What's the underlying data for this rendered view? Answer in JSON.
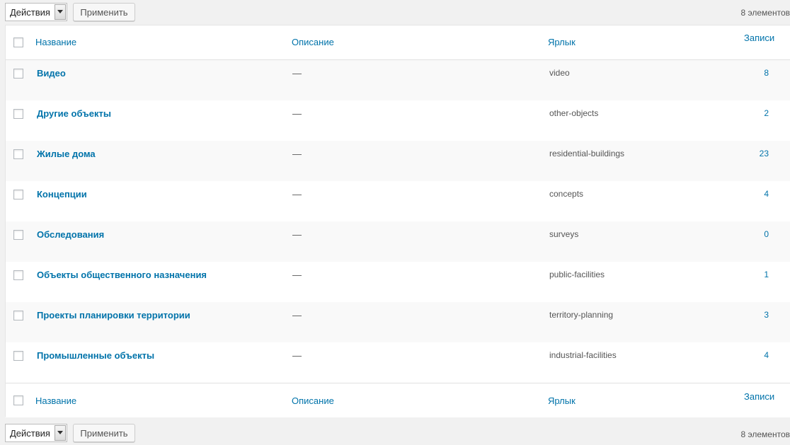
{
  "bulk_actions": {
    "select_label": "Действия",
    "apply_label": "Применить"
  },
  "items_count": "8 элементов",
  "columns": {
    "name": "Название",
    "description": "Описание",
    "slug": "Ярлык",
    "posts": "Записи"
  },
  "rows": [
    {
      "name": "Видео",
      "description": "—",
      "slug": "video",
      "count": "8"
    },
    {
      "name": "Другие объекты",
      "description": "—",
      "slug": "other-objects",
      "count": "2"
    },
    {
      "name": "Жилые дома",
      "description": "—",
      "slug": "residential-buildings",
      "count": "23"
    },
    {
      "name": "Концепции",
      "description": "—",
      "slug": "concepts",
      "count": "4"
    },
    {
      "name": "Обследования",
      "description": "—",
      "slug": "surveys",
      "count": "0"
    },
    {
      "name": "Объекты общественного назначения",
      "description": "—",
      "slug": "public-facilities",
      "count": "1"
    },
    {
      "name": "Проекты планировки территории",
      "description": "—",
      "slug": "territory-planning",
      "count": "3"
    },
    {
      "name": "Промышленные объекты",
      "description": "—",
      "slug": "industrial-facilities",
      "count": "4"
    }
  ],
  "colors": {
    "link": "#0073aa",
    "text": "#555555",
    "background": "#f1f1f1",
    "row_alt": "#f9f9f9"
  }
}
